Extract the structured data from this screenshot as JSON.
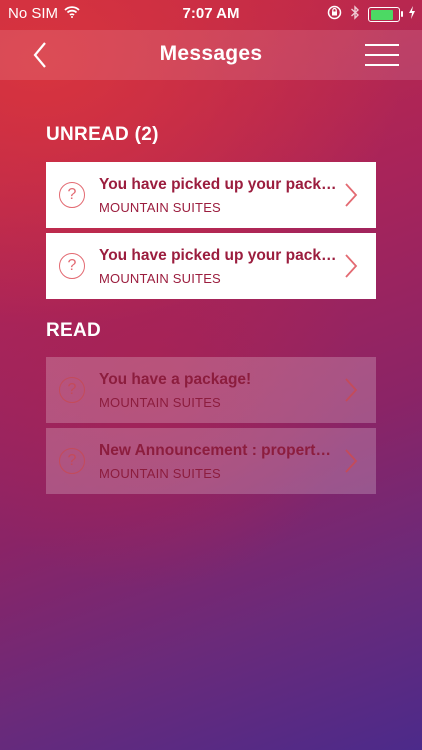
{
  "status": {
    "carrier": "No SIM",
    "time": "7:07 AM"
  },
  "nav": {
    "title": "Messages"
  },
  "unread": {
    "heading": "UNREAD (2)",
    "items": [
      {
        "title": "You have picked up your package!",
        "subtitle": "MOUNTAIN SUITES"
      },
      {
        "title": "You have picked up your package!",
        "subtitle": "MOUNTAIN SUITES"
      }
    ]
  },
  "read": {
    "heading": "READ",
    "items": [
      {
        "title": "You have a package!",
        "subtitle": "MOUNTAIN SUITES"
      },
      {
        "title": "New Announcement : property in...",
        "subtitle": "MOUNTAIN SUITES"
      }
    ]
  },
  "icons": {
    "question": "?",
    "wifi": "wifi-icon",
    "rotation_lock": "rotation-lock-icon",
    "bluetooth": "bluetooth-icon",
    "battery": "battery-icon"
  },
  "colors": {
    "card_text": "#9b1d3e",
    "icon_accent": "#e36a72",
    "battery": "#4cd964"
  },
  "battery_level": 0.85
}
